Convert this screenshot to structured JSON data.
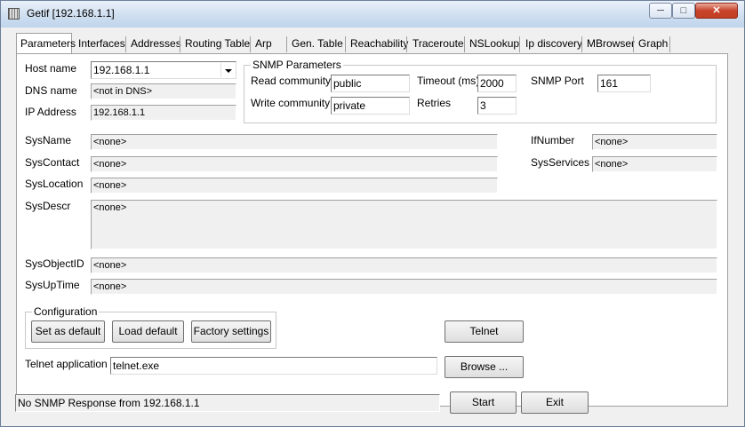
{
  "window": {
    "title": "Getif [192.168.1.1]"
  },
  "tabs": [
    "Parameters",
    "Interfaces",
    "Addresses",
    "Routing Table",
    "Arp",
    "Gen. Table",
    "Reachability",
    "Traceroute",
    "NSLookup",
    "Ip discovery",
    "MBrowser",
    "Graph"
  ],
  "host": {
    "host_label": "Host name",
    "host_value": "192.168.1.1",
    "dns_label": "DNS name",
    "dns_value": "<not in DNS>",
    "ip_label": "IP Address",
    "ip_value": "192.168.1.1"
  },
  "snmp": {
    "title": "SNMP Parameters",
    "read_label": "Read community",
    "read_value": "public",
    "write_label": "Write community",
    "write_value": "private",
    "timeout_label": "Timeout (ms)",
    "timeout_value": "2000",
    "retries_label": "Retries",
    "retries_value": "3",
    "port_label": "SNMP Port",
    "port_value": "161"
  },
  "sys": {
    "name_label": "SysName",
    "name_value": "<none>",
    "contact_label": "SysContact",
    "contact_value": "<none>",
    "location_label": "SysLocation",
    "location_value": "<none>",
    "descr_label": "SysDescr",
    "descr_value": "<none>",
    "objectid_label": "SysObjectID",
    "objectid_value": "<none>",
    "uptime_label": "SysUpTime",
    "uptime_value": "<none>",
    "ifnumber_label": "IfNumber",
    "ifnumber_value": "<none>",
    "services_label": "SysServices",
    "services_value": "<none>"
  },
  "config": {
    "title": "Configuration",
    "set_default": "Set as default",
    "load_default": "Load default",
    "factory": "Factory settings"
  },
  "telnet": {
    "button": "Telnet",
    "app_label": "Telnet application",
    "app_value": "telnet.exe",
    "browse": "Browse ..."
  },
  "footer": {
    "status": "No SNMP Response from 192.168.1.1",
    "start": "Start",
    "exit": "Exit"
  }
}
